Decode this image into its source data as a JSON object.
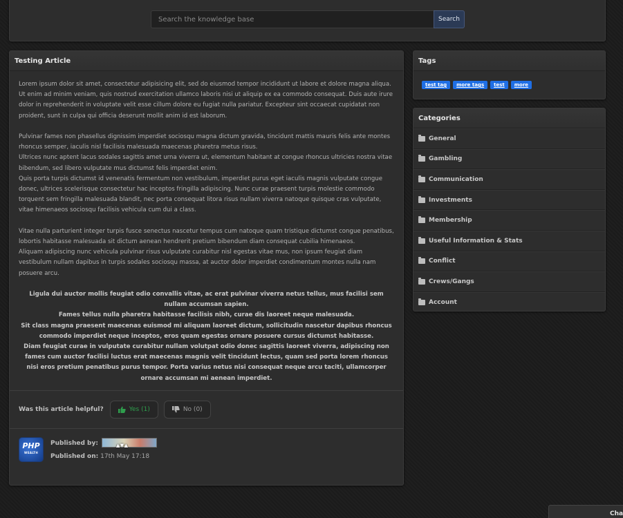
{
  "search": {
    "placeholder": "Search the knowledge base",
    "button_label": "Search"
  },
  "article": {
    "title": "Testing Article",
    "paragraphs": [
      "Lorem ipsum dolor sit amet, consectetur adipisicing elit, sed do eiusmod tempor incididunt ut labore et dolore magna aliqua. Ut enim ad minim veniam, quis nostrud exercitation ullamco laboris nisi ut aliquip ex ea commodo consequat. Duis aute irure dolor in reprehenderit in voluptate velit esse cillum dolore eu fugiat nulla pariatur. Excepteur sint occaecat cupidatat non proident, sunt in culpa qui officia deserunt mollit anim id est laborum.",
      "Pulvinar fames non phasellus dignissim imperdiet sociosqu magna dictum gravida, tincidunt mattis mauris felis ante montes rhoncus semper, iaculis nisl facilisis malesuada maecenas pharetra metus risus.",
      "Ultrices nunc aptent lacus sodales sagittis amet urna viverra ut, elementum habitant at congue rhoncus ultricies nostra vitae bibendum, sed libero vulputate mus dictumst felis imperdiet enim.",
      "Quis porta turpis dictumst id venenatis fermentum non vestibulum, imperdiet purus eget iaculis magnis vulputate congue donec, ultrices scelerisque consectetur hac inceptos fringilla adipiscing. Nunc curae praesent turpis molestie commodo torquent sem fringilla malesuada blandit, nec porta consequat litora risus nullam viverra natoque quisque cras vulputate, vitae himenaeos sociosqu facilisis vehicula cum dui a class.",
      "Vitae nulla parturient integer turpis fusce senectus nascetur tempus cum natoque quam tristique dictumst congue penatibus, lobortis habitasse malesuada sit dictum aenean hendrerit pretium bibendum diam consequat cubilia himenaeos.",
      "Aliquam adipiscing nunc vehicula pulvinar risus vulputate curabitur nisl egestas vitae mus, non ipsum feugiat diam vestibulum nullam dapibus in turpis sodales sociosqu massa, at auctor dolor imperdiet condimentum montes nulla nam posuere arcu."
    ],
    "centered_lines": [
      "Ligula dui auctor mollis feugiat odio convallis vitae, ac erat pulvinar viverra netus tellus, mus facilisi sem nullam accumsan sapien.",
      "Fames tellus nulla pharetra habitasse facilisis nibh, curae dis laoreet neque malesuada.",
      "Sit class magna praesent maecenas euismod mi aliquam laoreet dictum, sollicitudin nascetur dapibus rhoncus commodo imperdiet neque inceptos, eros quam egestas ornare posuere cursus dictumst habitasse.",
      "Diam feugiat curae in vulputate curabitur nullam volutpat odio donec sagittis laoreet viverra, adipiscing non fames cum auctor facilisi luctus erat maecenas magnis velit tincidunt lectus, quam sed porta lorem rhoncus nisi eros pretium penatibus purus tempor. Porta varius netus nisi consequat neque arcu taciti, ullamcorper ornare accumsan mi aenean imperdiet."
    ],
    "helpful_label": "Was this article helpful?",
    "yes_label": "Yes (1)",
    "no_label": "No (0)",
    "published_by_label": "Published by:",
    "published_on_label": "Published on:",
    "published_on_value": "17th May 17:18",
    "author_logo_text": "PHP",
    "author_logo_sub": "WEALTH"
  },
  "tags": {
    "title": "Tags",
    "items": [
      "test tag",
      "more tags",
      "test",
      "more"
    ]
  },
  "categories": {
    "title": "Categories",
    "items": [
      "General",
      "Gambling",
      "Communication",
      "Investments",
      "Membership",
      "Useful Information & Stats",
      "Conflict",
      "Crews/Gangs",
      "Account"
    ]
  },
  "chat": {
    "label": "Chat"
  },
  "colors": {
    "tag_bg": "#1f6fe5",
    "yes_green": "#2f9e4d",
    "search_button": "#2b3a55"
  },
  "icons": {
    "thumbs_up": "thumbs-up-icon",
    "thumbs_down": "thumbs-down-icon",
    "folder": "folder-icon"
  }
}
